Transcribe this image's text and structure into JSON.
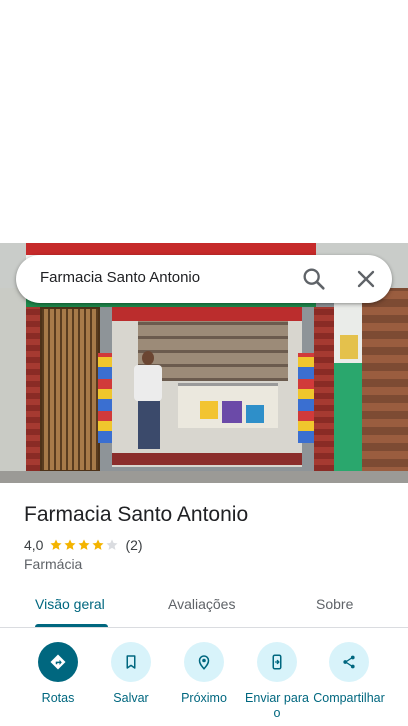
{
  "search": {
    "query": "Farmacia Santo Antonio"
  },
  "place": {
    "name": "Farmacia Santo Antonio",
    "rating": "4,0",
    "stars_filled": 4,
    "stars_total": 5,
    "review_count": "(2)",
    "category": "Farmácia"
  },
  "tabs": [
    {
      "label": "Visão geral",
      "active": true
    },
    {
      "label": "Avaliações",
      "active": false
    },
    {
      "label": "Sobre",
      "active": false
    }
  ],
  "actions": [
    {
      "label": "Rotas",
      "icon": "directions-icon"
    },
    {
      "label": "Salvar",
      "icon": "bookmark-icon"
    },
    {
      "label": "Próximo",
      "icon": "nearby-icon"
    },
    {
      "label": "Enviar para o",
      "icon": "send-to-phone-icon"
    },
    {
      "label": "Compartilhar",
      "icon": "share-icon"
    }
  ],
  "colors": {
    "accent": "#00677f",
    "action_bg": "#d8f3fa",
    "star": "#f4b400",
    "star_empty": "#dadce0"
  }
}
